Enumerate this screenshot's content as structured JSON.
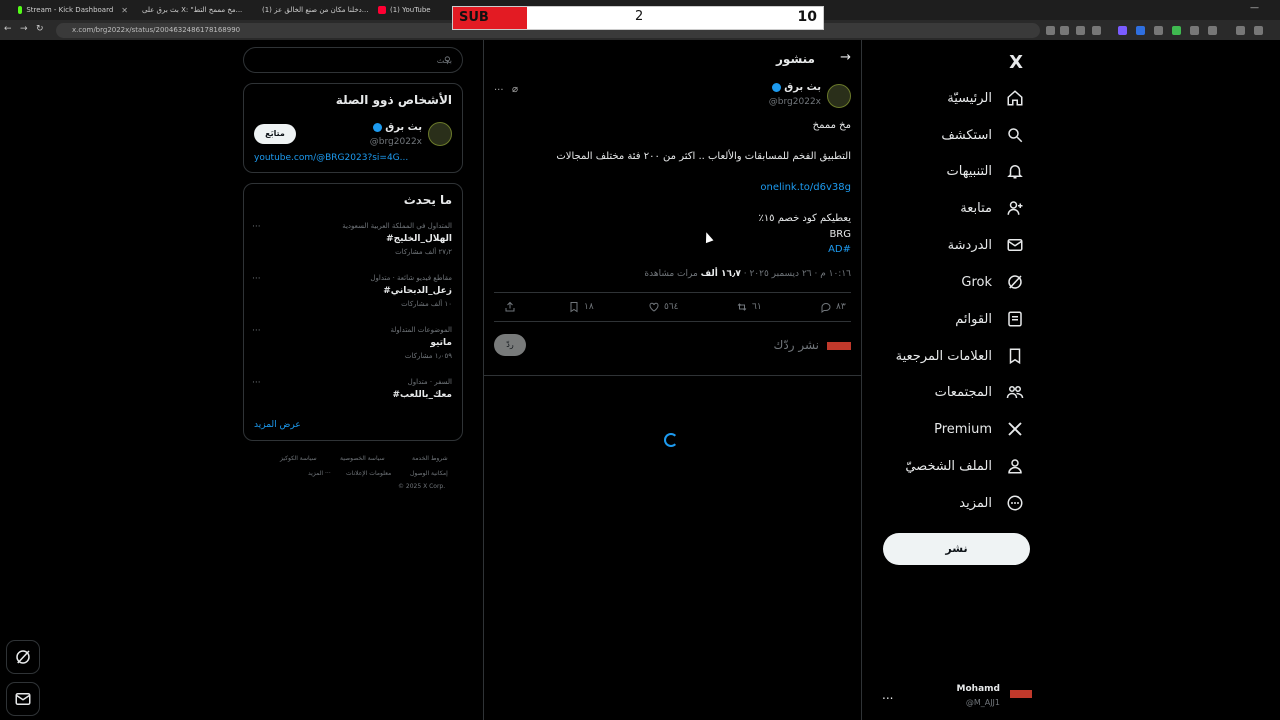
{
  "browser": {
    "tabs": [
      {
        "label": "Stream - Kick Dashboard",
        "fav_color": "#53fc18"
      },
      {
        "label": "بث برق على X: \"مخ مممخ التط...",
        "fav_color": "#e7e9ea"
      },
      {
        "label": "(1) دخلنا مكان من صنع الخالق عز...",
        "fav_color": "#ff0033"
      },
      {
        "label": "(1) YouTube",
        "fav_color": "#ff0033"
      }
    ],
    "url": "x.com/brg2022x/status/2004632486178168990"
  },
  "overlay": {
    "label": "SUB",
    "count": "2",
    "goal": "10"
  },
  "nav": {
    "logo": "X",
    "items": [
      {
        "label": "الرئيسيّة",
        "icon": "home-icon"
      },
      {
        "label": "استكشف",
        "icon": "search-icon"
      },
      {
        "label": "التنبيهات",
        "icon": "bell-icon"
      },
      {
        "label": "متابعة",
        "icon": "add-person-icon"
      },
      {
        "label": "الدردشة",
        "icon": "mail-icon"
      },
      {
        "label": "Grok",
        "icon": "grok-icon"
      },
      {
        "label": "القوائم",
        "icon": "list-icon"
      },
      {
        "label": "العلامات المرجعية",
        "icon": "bookmark-icon"
      },
      {
        "label": "المجتمعات",
        "icon": "people-icon"
      },
      {
        "label": "Premium",
        "icon": "x-icon"
      },
      {
        "label": "الملف الشخصيّ",
        "icon": "person-icon"
      },
      {
        "label": "المزيد",
        "icon": "more-circle-icon"
      }
    ],
    "post_button": "نشر",
    "account": {
      "name": "Mohamd",
      "handle": "@M_AJJ1",
      "more": "..."
    }
  },
  "post": {
    "header_title": "منشور",
    "author_name": "بث برق",
    "author_handle": "@brg2022x",
    "more": "...",
    "lines": [
      "مخ مممخ",
      "التطبيق الفخم للمسابقات والألعاب .. اكثر من ٢٠٠ فئة مختلف المجالات",
      "onelink.to/d6v38g",
      "يعطيكم كود  خصم ١٥٪",
      "BRG",
      "#AD"
    ],
    "meta_time": "١٠:١٦ م · ٢٦ ديسمبر ٢٠٢٥ · ",
    "meta_views": "١٦٫٧ ألف",
    "meta_views_label": " مرات مشاهدة",
    "actions": {
      "replies": "٨٣",
      "reposts": "٦١",
      "likes": "٥٦٤",
      "bookmarks": "١٨"
    },
    "reply_placeholder": "نشر ردّك",
    "reply_button": "ردّ"
  },
  "search": {
    "placeholder": "بحث"
  },
  "who_to_follow": {
    "title": "الأشخاص ذوو الصلة",
    "name": "بث برق",
    "handle": "@brg2022x",
    "follow_label": "متابَع",
    "link": "youtube.com/@BRG2023?si=4G..."
  },
  "trends": {
    "title": "ما يحدث",
    "items": [
      {
        "context": "المتداول في المملكة العربية السعودية",
        "name": "#الهلال_الخليج",
        "count": "٢٧٫٢ ألف مشاركات"
      },
      {
        "context": "مقاطع فيديو شائعة · متداول",
        "name": "#زعل_الدبحاني",
        "count": "١٠ ألف مشاركات"
      },
      {
        "context": "الموضوعات المتداولة",
        "name": "ماتيو",
        "count": "١٫٠٥٩ مشاركات"
      },
      {
        "context": "السفر · متداول",
        "name": "#معك_باللعب",
        "count": ""
      }
    ],
    "show_more": "عرض المزيد"
  },
  "footer": {
    "row1": [
      "شروط الخدمة",
      "سياسة الخصوصية",
      "سياسة الكوكيز"
    ],
    "row2": [
      "إمكانية الوصول",
      "معلومات الإعلانات",
      "المزيد ···"
    ],
    "copyright": "© 2025 X Corp."
  }
}
